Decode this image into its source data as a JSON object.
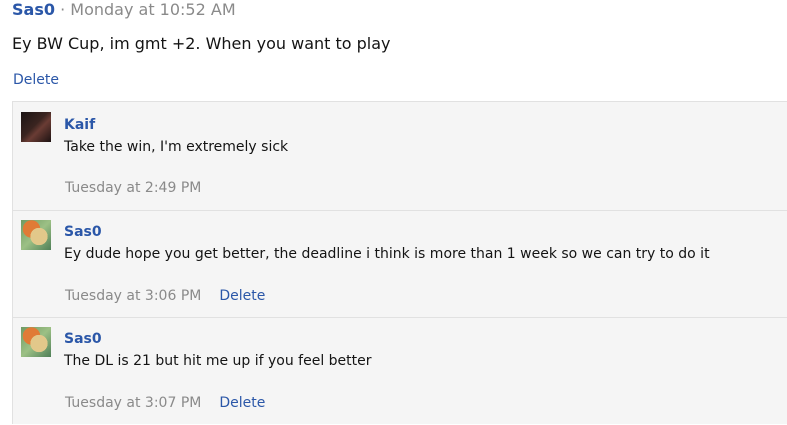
{
  "post": {
    "author": "Sas0",
    "separator": "·",
    "time": "Monday at 10:52 AM",
    "body": "Ey BW Cup, im gmt +2. When you want to play",
    "delete_label": "Delete"
  },
  "replies": [
    {
      "author": "Kaif",
      "text": "Take the win, I'm extremely sick",
      "time": "Tuesday at 2:49 PM",
      "delete_label": ""
    },
    {
      "author": "Sas0",
      "text": "Ey dude hope you get better, the deadline i think is more than 1 week so we can try to do it",
      "time": "Tuesday at 3:06 PM",
      "delete_label": "Delete"
    },
    {
      "author": "Sas0",
      "text": "The DL is 21 but hit me up if you feel better",
      "time": "Tuesday at 3:07 PM",
      "delete_label": "Delete"
    }
  ]
}
